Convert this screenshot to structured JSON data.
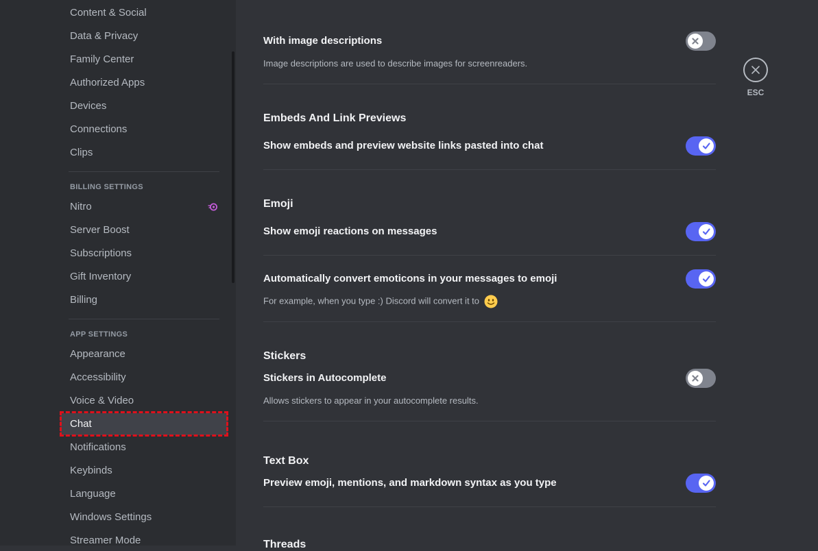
{
  "sidebar": {
    "items_top": [
      {
        "label": "Content & Social"
      },
      {
        "label": "Data & Privacy"
      },
      {
        "label": "Family Center"
      },
      {
        "label": "Authorized Apps"
      },
      {
        "label": "Devices"
      },
      {
        "label": "Connections"
      },
      {
        "label": "Clips"
      }
    ],
    "billing_heading": "BILLING SETTINGS",
    "billing_items": [
      {
        "label": "Nitro"
      },
      {
        "label": "Server Boost"
      },
      {
        "label": "Subscriptions"
      },
      {
        "label": "Gift Inventory"
      },
      {
        "label": "Billing"
      }
    ],
    "app_heading": "APP SETTINGS",
    "app_items": [
      {
        "label": "Appearance"
      },
      {
        "label": "Accessibility"
      },
      {
        "label": "Voice & Video"
      },
      {
        "label": "Chat",
        "selected": true
      },
      {
        "label": "Notifications"
      },
      {
        "label": "Keybinds"
      },
      {
        "label": "Language"
      },
      {
        "label": "Windows Settings"
      },
      {
        "label": "Streamer Mode"
      }
    ]
  },
  "content": {
    "image_descriptions": {
      "title": "With image descriptions",
      "desc": "Image descriptions are used to describe images for screenreaders.",
      "enabled": false
    },
    "embeds": {
      "section": "Embeds And Link Previews",
      "title": "Show embeds and preview website links pasted into chat",
      "enabled": true
    },
    "emoji": {
      "section": "Emoji",
      "reactions_title": "Show emoji reactions on messages",
      "reactions_enabled": true,
      "convert_title": "Automatically convert emoticons in your messages to emoji",
      "convert_desc": "For example, when you type :) Discord will convert it to",
      "convert_enabled": true
    },
    "stickers": {
      "section": "Stickers",
      "title": "Stickers in Autocomplete",
      "desc": "Allows stickers to appear in your autocomplete results.",
      "enabled": false
    },
    "textbox": {
      "section": "Text Box",
      "title": "Preview emoji, mentions, and markdown syntax as you type",
      "enabled": true
    },
    "threads": {
      "section": "Threads"
    }
  },
  "close": {
    "label": "ESC"
  },
  "colors": {
    "accent": "#5865f2",
    "toggle_off": "#80848e",
    "highlight": "#e0101b",
    "nitro": "#c45bd9"
  },
  "icons": [
    "nitro-icon",
    "close-icon",
    "check-icon",
    "x-icon",
    "smile-emoji-icon"
  ]
}
